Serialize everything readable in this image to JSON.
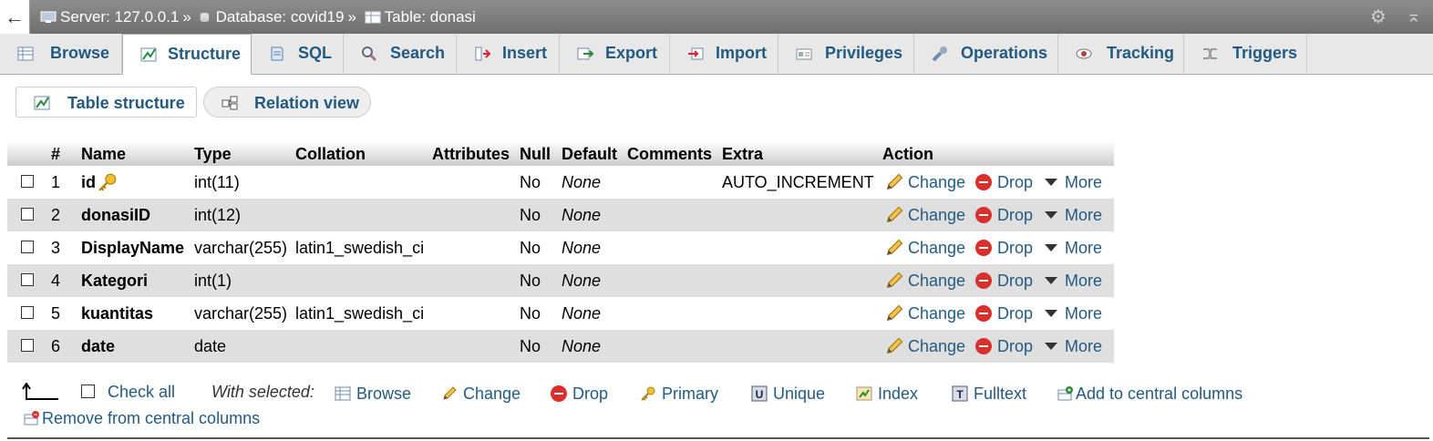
{
  "breadcrumb": {
    "back_glyph": "←",
    "server": "Server: 127.0.0.1",
    "database": "Database: covid19",
    "table": "Table: donasi",
    "separator": "»"
  },
  "tabs": [
    {
      "label": "Browse",
      "icon": "browse-icon"
    },
    {
      "label": "Structure",
      "icon": "structure-icon",
      "active": true
    },
    {
      "label": "SQL",
      "icon": "sql-icon"
    },
    {
      "label": "Search",
      "icon": "search-icon"
    },
    {
      "label": "Insert",
      "icon": "insert-icon"
    },
    {
      "label": "Export",
      "icon": "export-icon"
    },
    {
      "label": "Import",
      "icon": "import-icon"
    },
    {
      "label": "Privileges",
      "icon": "privileges-icon"
    },
    {
      "label": "Operations",
      "icon": "wrench-icon"
    },
    {
      "label": "Tracking",
      "icon": "eye-icon"
    },
    {
      "label": "Triggers",
      "icon": "triggers-icon"
    }
  ],
  "subtabs": {
    "table_structure": "Table structure",
    "relation_view": "Relation view"
  },
  "table": {
    "headers": {
      "num": "#",
      "name": "Name",
      "type": "Type",
      "collation": "Collation",
      "attributes": "Attributes",
      "null": "Null",
      "default": "Default",
      "comments": "Comments",
      "extra": "Extra",
      "action": "Action"
    },
    "rows": [
      {
        "num": "1",
        "name": "id",
        "type": "int(11)",
        "collation": "",
        "null": "No",
        "default": "None",
        "extra": "AUTO_INCREMENT",
        "primary": true
      },
      {
        "num": "2",
        "name": "donasiID",
        "type": "int(12)",
        "collation": "",
        "null": "No",
        "default": "None",
        "extra": ""
      },
      {
        "num": "3",
        "name": "DisplayName",
        "type": "varchar(255)",
        "collation": "latin1_swedish_ci",
        "null": "No",
        "default": "None",
        "extra": ""
      },
      {
        "num": "4",
        "name": "Kategori",
        "type": "int(1)",
        "collation": "",
        "null": "No",
        "default": "None",
        "extra": ""
      },
      {
        "num": "5",
        "name": "kuantitas",
        "type": "varchar(255)",
        "collation": "latin1_swedish_ci",
        "null": "No",
        "default": "None",
        "extra": ""
      },
      {
        "num": "6",
        "name": "date",
        "type": "date",
        "collation": "",
        "null": "No",
        "default": "None",
        "extra": ""
      }
    ],
    "actions": {
      "change": "Change",
      "drop": "Drop",
      "more": "More"
    }
  },
  "footer": {
    "check_all": "Check all",
    "with_selected": "With selected:",
    "browse": "Browse",
    "change": "Change",
    "drop": "Drop",
    "primary": "Primary",
    "unique": "Unique",
    "index": "Index",
    "fulltext": "Fulltext",
    "add_central": "Add to central columns",
    "remove_central": "Remove from central columns"
  },
  "colors": {
    "link": "#235a81",
    "drop": "#d9302c",
    "row_alt": "#dfdfdf"
  }
}
